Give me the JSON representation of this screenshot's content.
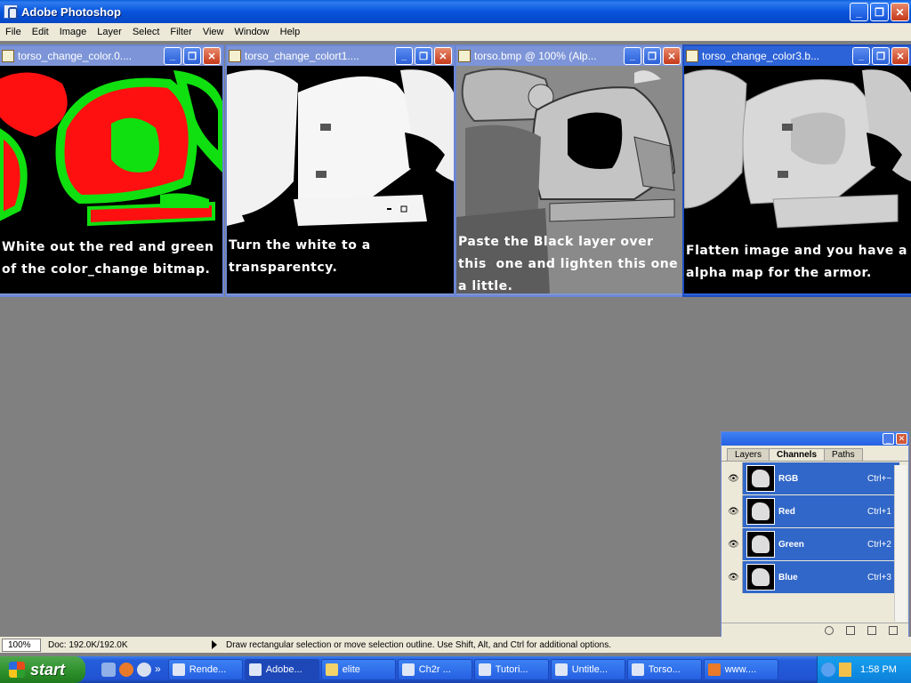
{
  "app": {
    "title": "Adobe Photoshop",
    "window_buttons": [
      "_",
      "❐",
      "✕"
    ]
  },
  "menu": [
    "File",
    "Edit",
    "Image",
    "Layer",
    "Select",
    "Filter",
    "View",
    "Window",
    "Help"
  ],
  "documents": [
    {
      "title": "torso_change_color.0....",
      "caption": "White out the red and green\nof the color_change bitmap."
    },
    {
      "title": "torso_change_colort1....",
      "caption": "Turn the white to a\ntransparentcy."
    },
    {
      "title": "torso.bmp @ 100% (Alp...",
      "caption": "Paste the Black layer over\nthis  one and lighten this one\na little."
    },
    {
      "title": "torso_change_color3.b...",
      "caption": "Flatten image and you have a\nalpha map for the armor."
    }
  ],
  "palette": {
    "tabs": [
      "Layers",
      "Channels",
      "Paths"
    ],
    "active_tab": "Channels",
    "channels": [
      {
        "name": "RGB",
        "shortcut": "Ctrl+~"
      },
      {
        "name": "Red",
        "shortcut": "Ctrl+1"
      },
      {
        "name": "Green",
        "shortcut": "Ctrl+2"
      },
      {
        "name": "Blue",
        "shortcut": "Ctrl+3"
      }
    ]
  },
  "status": {
    "zoom": "100%",
    "doc_size": "Doc: 192.0K/192.0K",
    "hint": "Draw rectangular selection or move selection outline.  Use Shift, Alt, and Ctrl for additional options."
  },
  "taskbar": {
    "start_label": "start",
    "tasks": [
      "Rende...",
      "Adobe...",
      "elite",
      "Ch2r ...",
      "Tutori...",
      "Untitle...",
      "Torso...",
      "www...."
    ],
    "clock": "1:58 PM",
    "quicklaunch_more": "»"
  },
  "colors": {
    "xp_blue": "#0855dd",
    "workspace_gray": "#808080",
    "start_green": "#2c8f2a",
    "channel_highlight": "#3167c8"
  }
}
